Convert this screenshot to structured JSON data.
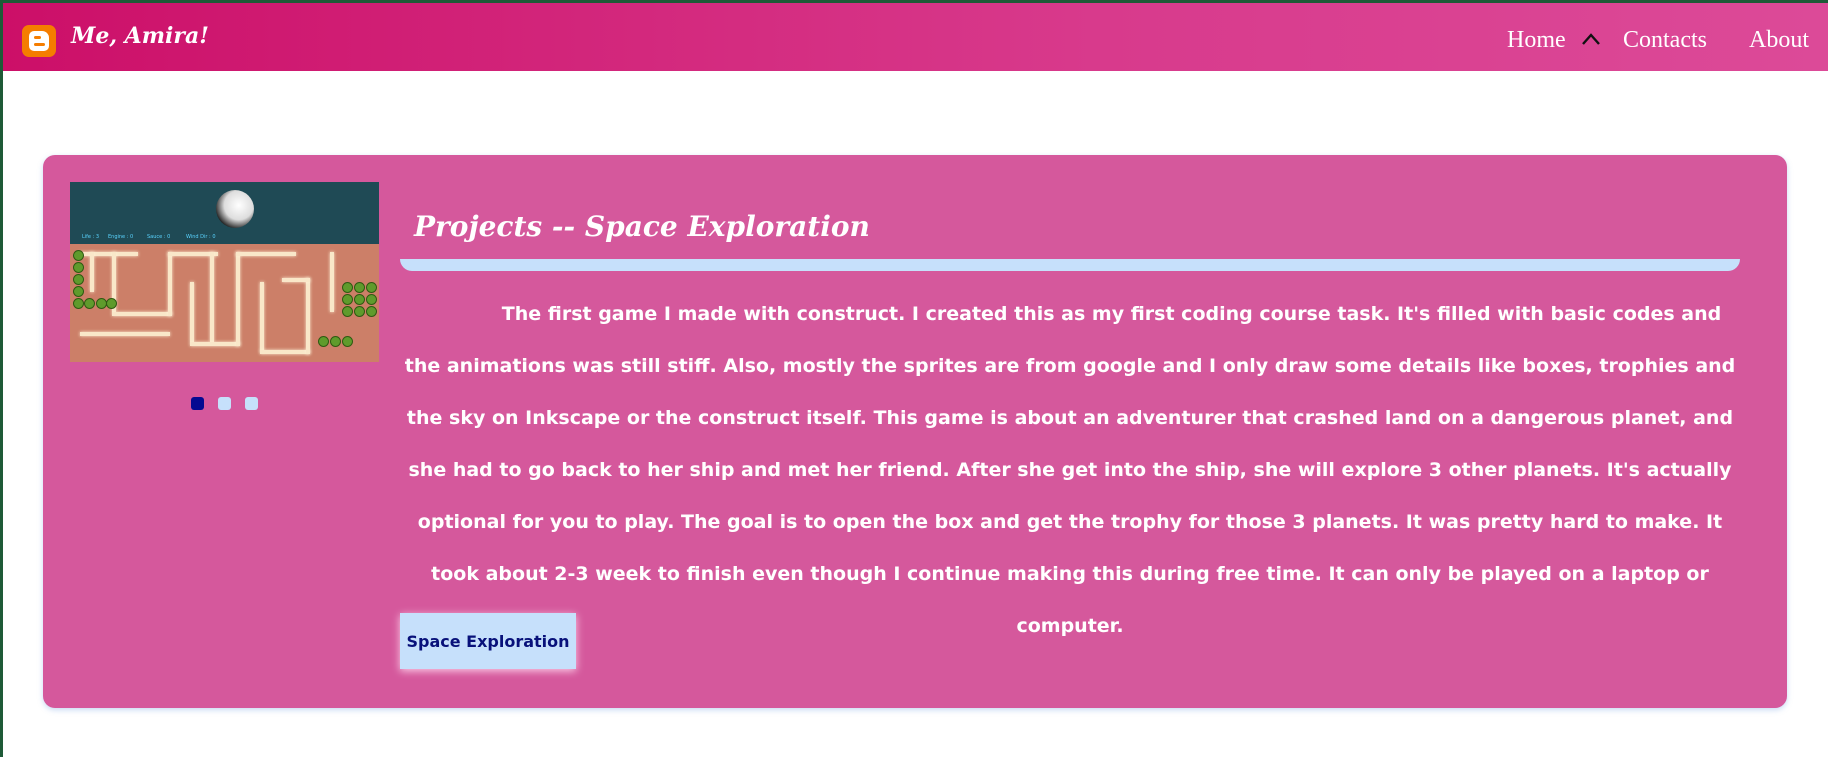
{
  "navbar": {
    "brand_icon": "blogger-icon",
    "brand_title": "Me, Amira!",
    "links": [
      {
        "label": "Home"
      },
      {
        "label": "Contacts"
      },
      {
        "label": "About"
      }
    ],
    "chevron_icon": "chevron-up-icon"
  },
  "project_card": {
    "title": "Projects -- Space Exploration",
    "description": "The first game I made with construct. I created this as my first coding course task. It's filled with basic codes and the animations was still stiff. Also, mostly the sprites are from google and I only draw some details like boxes, trophies and the sky on Inkscape or the construct itself. This game is about an adventurer that crashed land on a dangerous planet, and she had to go back to her ship and met her friend. After she get into the ship, she will explore 3 other planets. It's actually optional for you to play. The goal is to open the box and get the trophy for those 3 planets. It was pretty hard to make. It took about 2-3 week to finish even though I continue making this during free time. It can only be played on a laptop or computer.",
    "button_label": "Space Exploration",
    "carousel": {
      "slides": 3,
      "active_index": 0
    }
  },
  "colors": {
    "navbar_start": "#cc0f68",
    "navbar_end": "#dc4a98",
    "card_background": "#d5589c",
    "accent_light_blue": "#c6e0fb",
    "active_dot": "#040a91",
    "brand_icon": "#f57d00"
  }
}
